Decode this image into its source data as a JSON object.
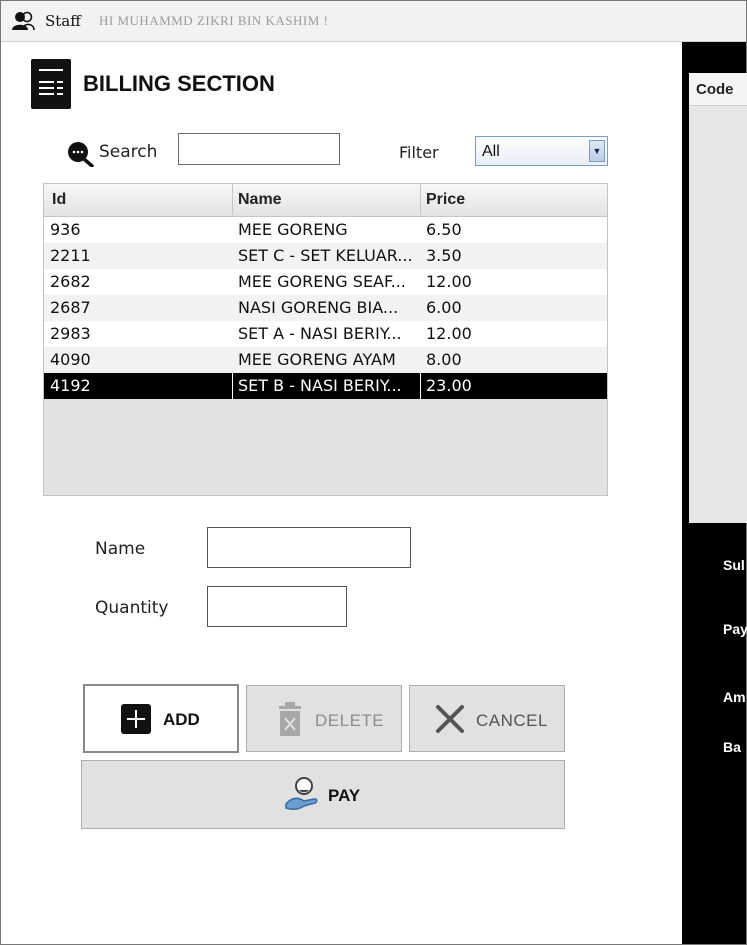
{
  "window": {
    "app_title": "Staff",
    "greeting": "HI MUHAMMD ZIKRI BIN KASHIM !"
  },
  "billing": {
    "title": "BILLING SECTION"
  },
  "search": {
    "label": "Search",
    "value": "",
    "filter_label": "Filter",
    "filter_selected": "All"
  },
  "table": {
    "columns": [
      "Id",
      "Name",
      "Price"
    ],
    "rows": [
      {
        "id": "936",
        "name": "MEE GORENG",
        "price": "6.50"
      },
      {
        "id": "2211",
        "name": "SET C - SET KELUAR...",
        "price": "3.50"
      },
      {
        "id": "2682",
        "name": "MEE GORENG SEAF...",
        "price": "12.00"
      },
      {
        "id": "2687",
        "name": "NASI GORENG BIA...",
        "price": "6.00"
      },
      {
        "id": "2983",
        "name": "SET A - NASI BERIY...",
        "price": "12.00"
      },
      {
        "id": "4090",
        "name": "MEE GORENG AYAM",
        "price": "8.00"
      },
      {
        "id": "4192",
        "name": "SET B - NASI BERIY...",
        "price": "23.00"
      }
    ],
    "selected_id": "4192"
  },
  "form": {
    "name_label": "Name",
    "name_value": "",
    "quantity_label": "Quantity",
    "quantity_value": ""
  },
  "buttons": {
    "add": "ADD",
    "delete": "DELETE",
    "cancel": "CANCEL",
    "pay": "PAY"
  },
  "right_panel": {
    "code_header": "Code",
    "labels": [
      "Sul",
      "Pay",
      "Am",
      "Ba"
    ]
  },
  "colors": {
    "panel_black": "#000000",
    "selected_row": "#000000",
    "button_gray": "#e1e1e1"
  }
}
